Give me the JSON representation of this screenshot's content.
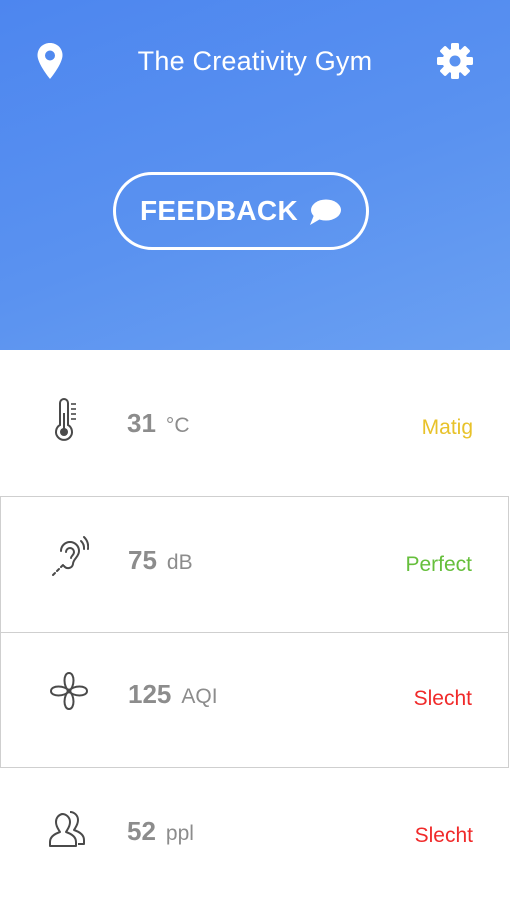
{
  "header": {
    "title": "The Creativity Gym",
    "location_icon": "location-pin-icon",
    "settings_icon": "gear-icon",
    "background_colors": [
      "#4d86ef",
      "#6aa0f2"
    ]
  },
  "feedback": {
    "label": "FEEDBACK",
    "icon": "chat-bubble-icon"
  },
  "metrics": [
    {
      "icon": "thermometer-icon",
      "value": "31",
      "unit": "°C",
      "status": "Matig",
      "status_color": "#e8c22a"
    },
    {
      "icon": "ear-sound-icon",
      "value": "75",
      "unit": "dB",
      "status": "Perfect",
      "status_color": "#66bf3c"
    },
    {
      "icon": "fan-icon",
      "value": "125",
      "unit": "AQI",
      "status": "Slecht",
      "status_color": "#f02a2a"
    },
    {
      "icon": "people-icon",
      "value": "52",
      "unit": "ppl",
      "status": "Slecht",
      "status_color": "#f02a2a"
    }
  ]
}
